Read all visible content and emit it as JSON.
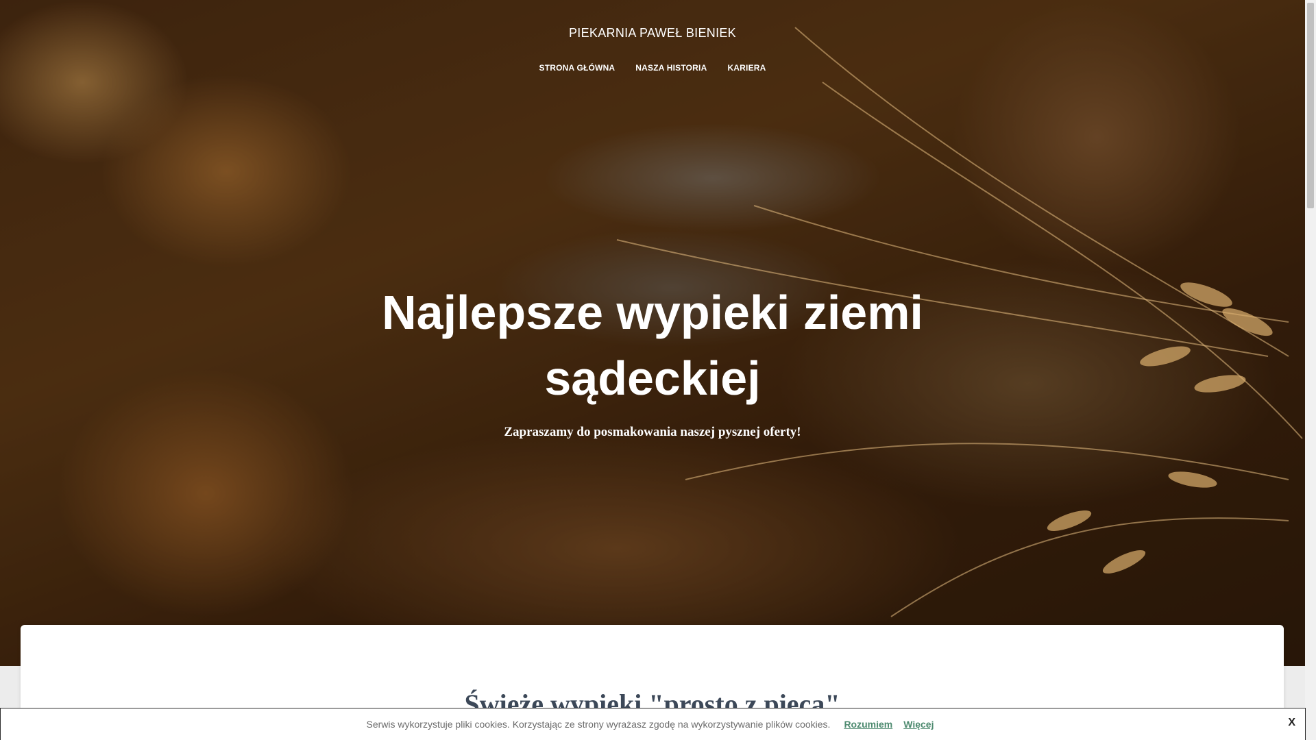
{
  "site": {
    "title": "PIEKARNIA PAWEŁ BIENIEK"
  },
  "nav": {
    "items": [
      {
        "label": "STRONA GŁÓWNA"
      },
      {
        "label": "NASZA HISTORIA"
      },
      {
        "label": "KARIERA"
      }
    ]
  },
  "hero": {
    "headline": "Najlepsze wypieki ziemi sądeckiej",
    "subtitle": "Zapraszamy do posmakowania naszej pysznej oferty!"
  },
  "section": {
    "title": "Świeże wypieki \"prosto z pieca\""
  },
  "cookie_bar": {
    "text": "Serwis wykorzystuje pliki cookies. Korzystając ze strony wyrażasz zgodę na wykorzystywanie plików cookies.",
    "accept_label": "Rozumiem",
    "more_label": "Więcej",
    "close_label": "X"
  },
  "colors": {
    "hero_overlay": "#000000",
    "link_accent": "#4d8a6f",
    "section_title": "#3c4858"
  }
}
